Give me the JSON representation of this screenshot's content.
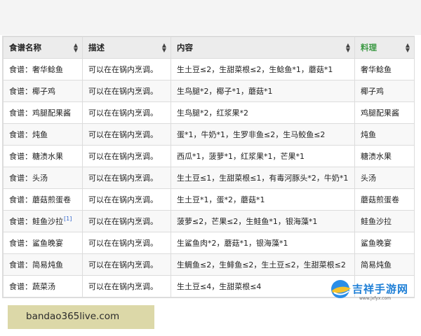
{
  "table": {
    "headers": {
      "recipe_name": "食谱名称",
      "description": "描述",
      "contents": "内容",
      "dish": "料理"
    },
    "rows": [
      {
        "name": "食谱：奢华鲶鱼",
        "desc": "可以在在锅内烹调。",
        "contents": "生土豆≤2，生甜菜根≤2，生鲶鱼*1，蘑菇*1",
        "dish": "奢华鲶鱼"
      },
      {
        "name": "食谱：椰子鸡",
        "desc": "可以在在锅内烹调。",
        "contents": "生鸟腿*2，椰子*1，蘑菇*1",
        "dish": "椰子鸡"
      },
      {
        "name": "食谱：鸡腿配果酱",
        "desc": "可以在在锅内烹调。",
        "contents": "生鸟腿*2，红浆果*2",
        "dish": "鸡腿配果酱"
      },
      {
        "name": "食谱：炖鱼",
        "desc": "可以在在锅内烹调。",
        "contents": "蛋*1，牛奶*1，生罗非鱼≤2，生马鲛鱼≤2",
        "dish": "炖鱼"
      },
      {
        "name": "食谱：糖渍水果",
        "desc": "可以在在锅内烹调。",
        "contents": "西瓜*1，菠萝*1，红浆果*1，芒果*1",
        "dish": "糖渍水果"
      },
      {
        "name": "食谱：头汤",
        "desc": "可以在在锅内烹调。",
        "contents": "生土豆≤1，生甜菜根≤1，有毒河豚头*2，牛奶*1",
        "dish": "头汤"
      },
      {
        "name": "食谱：蘑菇煎蛋卷",
        "desc": "可以在在锅内烹调。",
        "contents": "生土豆*1，蛋*2，蘑菇*1",
        "dish": "蘑菇煎蛋卷"
      },
      {
        "name": "食谱：鲑鱼沙拉",
        "note": "[1]",
        "desc": "可以在在锅内烹调。",
        "contents": "菠萝≤2，芒果≤2，生鲑鱼*1，银海藻*1",
        "dish": "鲑鱼沙拉"
      },
      {
        "name": "食谱：鲨鱼晚宴",
        "desc": "可以在在锅内烹调。",
        "contents": "生鲨鱼肉*2，蘑菇*1，银海藻*1",
        "dish": "鲨鱼晚宴"
      },
      {
        "name": "食谱：简易炖鱼",
        "desc": "可以在在锅内烹调。",
        "contents": "生鲷鱼≤2，生鲱鱼≤2，生土豆≤2，生甜菜根≤2",
        "dish": "简易炖鱼"
      },
      {
        "name": "食谱：蔬菜汤",
        "desc": "可以在在锅内烹调。",
        "contents": "生土豆≤4，生甜菜根≤4",
        "dish": ""
      }
    ]
  },
  "watermark": {
    "text": "吉祥手游网",
    "url": "www.jxfyx.com",
    "icon": "site-logo-icon"
  },
  "banner": {
    "url": "bandao365live.com"
  },
  "colors": {
    "dish_header": "#3d9a45",
    "header_bg": "#ececec",
    "banner_bg": "#dcd8a8",
    "watermark_blue": "#1e7fd6"
  }
}
